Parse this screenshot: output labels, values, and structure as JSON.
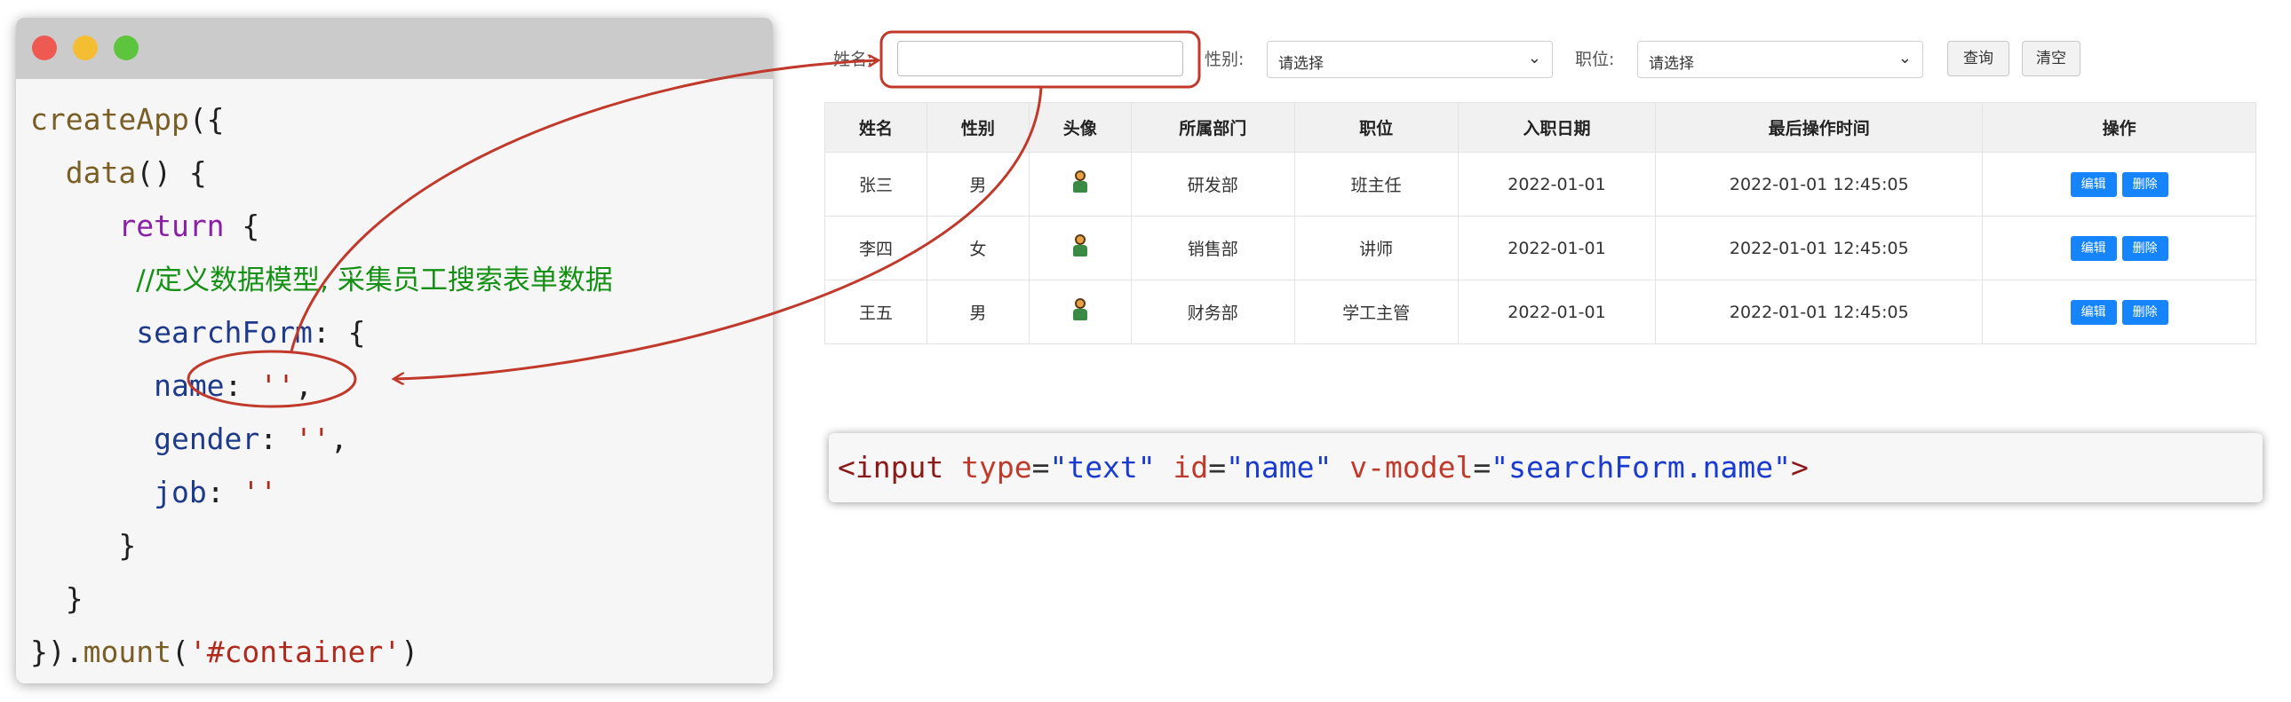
{
  "code": {
    "lines": [
      [
        {
          "t": "createApp",
          "c": "fn"
        },
        {
          "t": "({",
          "c": "plain"
        }
      ],
      [
        {
          "t": "  ",
          "c": "plain"
        },
        {
          "t": "data",
          "c": "fn"
        },
        {
          "t": "() {",
          "c": "plain"
        }
      ],
      [
        {
          "t": "     ",
          "c": "plain"
        },
        {
          "t": "return",
          "c": "kw"
        },
        {
          "t": " {",
          "c": "plain"
        }
      ],
      [
        {
          "t": "      ",
          "c": "plain"
        },
        {
          "t": "//定义数据模型, 采集员工搜索表单数据",
          "c": "cmt"
        }
      ],
      [
        {
          "t": "      ",
          "c": "plain"
        },
        {
          "t": "searchForm",
          "c": "prop"
        },
        {
          "t": ": {",
          "c": "plain"
        }
      ],
      [
        {
          "t": "       ",
          "c": "plain"
        },
        {
          "t": "name",
          "c": "prop"
        },
        {
          "t": ": ",
          "c": "plain"
        },
        {
          "t": "''",
          "c": "str"
        },
        {
          "t": ",",
          "c": "plain"
        }
      ],
      [
        {
          "t": "       ",
          "c": "plain"
        },
        {
          "t": "gender",
          "c": "prop"
        },
        {
          "t": ": ",
          "c": "plain"
        },
        {
          "t": "''",
          "c": "str"
        },
        {
          "t": ",",
          "c": "plain"
        }
      ],
      [
        {
          "t": "       ",
          "c": "plain"
        },
        {
          "t": "job",
          "c": "prop"
        },
        {
          "t": ": ",
          "c": "plain"
        },
        {
          "t": "''",
          "c": "str"
        }
      ],
      [
        {
          "t": "     }",
          "c": "plain"
        }
      ],
      [
        {
          "t": "  }",
          "c": "plain"
        }
      ],
      [
        {
          "t": "}).",
          "c": "plain"
        },
        {
          "t": "mount",
          "c": "fn"
        },
        {
          "t": "(",
          "c": "plain"
        },
        {
          "t": "'#container'",
          "c": "str"
        },
        {
          "t": ")",
          "c": "plain"
        }
      ]
    ]
  },
  "search": {
    "name_label": "姓名:",
    "name_value": "",
    "gender_label": "性别:",
    "gender_selected": "请选择",
    "job_label": "职位:",
    "job_selected": "请选择",
    "query_button": "查询",
    "clear_button": "清空"
  },
  "table": {
    "columns": [
      "姓名",
      "性别",
      "头像",
      "所属部门",
      "职位",
      "入职日期",
      "最后操作时间",
      "操作"
    ],
    "rows": [
      {
        "name": "张三",
        "gender": "男",
        "dept": "研发部",
        "job": "班主任",
        "entry": "2022-01-01",
        "updated": "2022-01-01 12:45:05"
      },
      {
        "name": "李四",
        "gender": "女",
        "dept": "销售部",
        "job": "讲师",
        "entry": "2022-01-01",
        "updated": "2022-01-01 12:45:05"
      },
      {
        "name": "王五",
        "gender": "男",
        "dept": "财务部",
        "job": "学工主管",
        "entry": "2022-01-01",
        "updated": "2022-01-01 12:45:05"
      }
    ],
    "edit_label": "编辑",
    "delete_label": "删除"
  },
  "snippet": {
    "tokens": [
      {
        "t": "<",
        "c": "tag"
      },
      {
        "t": "input",
        "c": "tag"
      },
      {
        "t": " ",
        "c": "eq"
      },
      {
        "t": "type",
        "c": "attr"
      },
      {
        "t": "=",
        "c": "eq"
      },
      {
        "t": "\"text\"",
        "c": "val"
      },
      {
        "t": " ",
        "c": "eq"
      },
      {
        "t": "id",
        "c": "attr"
      },
      {
        "t": "=",
        "c": "eq"
      },
      {
        "t": "\"name\"",
        "c": "val"
      },
      {
        "t": " ",
        "c": "eq"
      },
      {
        "t": "v-model",
        "c": "attr"
      },
      {
        "t": "=",
        "c": "eq"
      },
      {
        "t": "\"searchForm.name\"",
        "c": "val"
      },
      {
        "t": ">",
        "c": "tag"
      }
    ]
  },
  "colors": {
    "annotation": "#c0392b",
    "primary_button": "#1684fc"
  }
}
